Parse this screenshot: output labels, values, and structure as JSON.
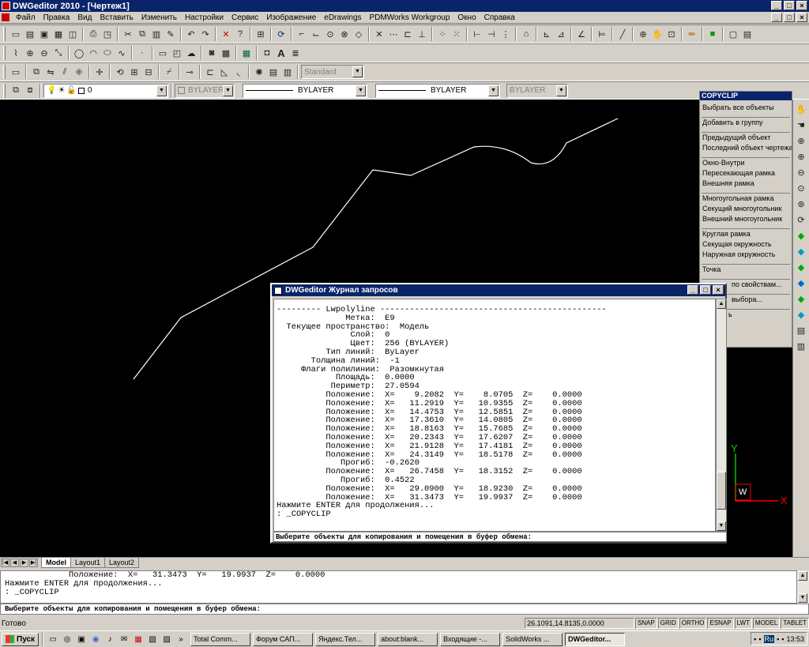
{
  "window": {
    "title": "DWGeditor 2010 - [Чертеж1]"
  },
  "menu": [
    "Файл",
    "Правка",
    "Вид",
    "Вставить",
    "Изменить",
    "Настройки",
    "Сервис",
    "Изображение",
    "eDrawings",
    "PDMWorks Workgroup",
    "Окно",
    "Справка"
  ],
  "toolbar": {
    "textstyle": "Standard",
    "layer": "0",
    "color": "BYLAYER",
    "linetype": "BYLAYER",
    "lineweight": "BYLAYER",
    "plotstyle": "BYLAYER"
  },
  "copyclip_panel": {
    "title": "COPYCLIP",
    "items": [
      "Выбрать все объекты",
      "Добавить в группу",
      "Предыдущий объект",
      "Последний объект чертежа",
      "Окно-Внутри",
      "Пересекающая рамка",
      "Внешняя рамка",
      "Многоугольная рамка",
      "Секущий многоугольник",
      "Внешний многоугольник",
      "Круглая рамка",
      "Секущая окружность",
      "Наружная окружность",
      "Точка",
      "по свойствам...",
      "выбора...",
      "ь"
    ]
  },
  "dialog": {
    "title": "DWGeditor Журнал запросов",
    "lines": [
      "--------- Lwpolyline ----------------------------------------------",
      "              Метка:  E9",
      "  Текущее пространство:  Модель",
      "               Слой:  0",
      "               Цвет:  256 (BYLAYER)",
      "          Тип линий:  ByLayer",
      "       Толщина линий:  -1",
      "     Флаги полилинии:  Разомкнутая",
      "            Площадь:  0.0000",
      "           Периметр:  27.0594",
      "          Положение:  X=    9.2082  Y=    8.0705  Z=    0.0000",
      "          Положение:  X=   11.2919  Y=   10.9355  Z=    0.0000",
      "          Положение:  X=   14.4753  Y=   12.5851  Z=    0.0000",
      "          Положение:  X=   17.3610  Y=   14.0805  Z=    0.0000",
      "          Положение:  X=   18.8163  Y=   15.7685  Z=    0.0000",
      "          Положение:  X=   20.2343  Y=   17.6207  Z=    0.0000",
      "          Положение:  X=   21.9128  Y=   17.4181  Z=    0.0000",
      "          Положение:  X=   24.3149  Y=   18.5178  Z=    0.0000",
      "             Прогиб:  -0.2620",
      "          Положение:  X=   26.7458  Y=   18.3152  Z=    0.0000",
      "             Прогиб:  0.4522",
      "          Положение:  X=   29.0900  Y=   18.9230  Z=    0.0000",
      "          Положение:  X=   31.3473  Y=   19.9937  Z=    0.0000",
      "Нажмите ENTER для продолжения...",
      ": _COPYCLIP"
    ],
    "prompt": "Выберите объекты для копирования и помещения в буфер обмена:"
  },
  "ucs": {
    "y_label": "Y",
    "x_label": "X",
    "w_label": "W"
  },
  "layout_tabs": [
    "Model",
    "Layout1",
    "Layout2"
  ],
  "command_window": {
    "lines": [
      "             Положение:  X=   31.3473  Y=   19.9937  Z=    0.0000",
      "Нажмите ENTER для продолжения...",
      ": _COPYCLIP"
    ],
    "prompt": "Выберите объекты для копирования и помещения в буфер обмена:"
  },
  "status": {
    "ready": "Готово",
    "coords": "26.1091,14.8135,0.0000",
    "buttons": [
      "SNAP",
      "GRID",
      "ORTHO",
      "ESNAP",
      "LWT",
      "MODEL",
      "TABLET"
    ]
  },
  "taskbar": {
    "start": "Пуск",
    "tasks": [
      "Total Comm...",
      "Форум САП...",
      "Яндекс.Тел...",
      "about:blank...",
      "Входящие -...",
      "SolidWorks ...",
      "DWGeditor..."
    ],
    "active_task": "DWGeditor...",
    "tray_lang": "Ru",
    "clock": "13:53"
  },
  "colors": {
    "canvas": "#000000",
    "titlebar": "#0a246a",
    "ucs_green": "#00c800",
    "ucs_red": "#ff0000"
  }
}
